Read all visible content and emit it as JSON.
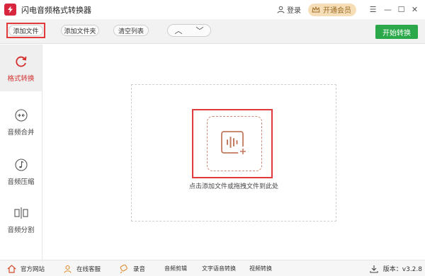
{
  "window": {
    "title": "闪电音频格式转换器",
    "login_label": "登录",
    "vip_label": "开通会员",
    "menu_symbol": "☰",
    "minimize_symbol": "—",
    "maximize_symbol": "☐",
    "close_symbol": "✕"
  },
  "toolbar": {
    "add_file": "添加文件",
    "add_folder": "添加文件夹",
    "clear_list": "清空列表",
    "move_up": "︿",
    "move_down": "﹀",
    "start": "开始转换"
  },
  "sidebar": {
    "items": [
      {
        "label": "格式转换",
        "icon": "refresh-icon",
        "active": true
      },
      {
        "label": "音频合并",
        "icon": "merge-icon",
        "active": false
      },
      {
        "label": "音频压缩",
        "icon": "music-note-icon",
        "active": false
      },
      {
        "label": "音频分割",
        "icon": "split-icon",
        "active": false
      }
    ]
  },
  "main": {
    "hint": "点击添加文件或拖拽文件到此处"
  },
  "statusbar": {
    "website": "官方网站",
    "online_service": "在线客服",
    "record": "录音",
    "audio_edit": "音频剪辑",
    "text_to_speech": "文字语音转换",
    "video_convert": "视频转换",
    "version": "版本：v3.2.8"
  },
  "colors": {
    "accent_red": "#d32f2f",
    "start_green": "#2aa84a",
    "vip_gold": "#f6dfb8"
  }
}
